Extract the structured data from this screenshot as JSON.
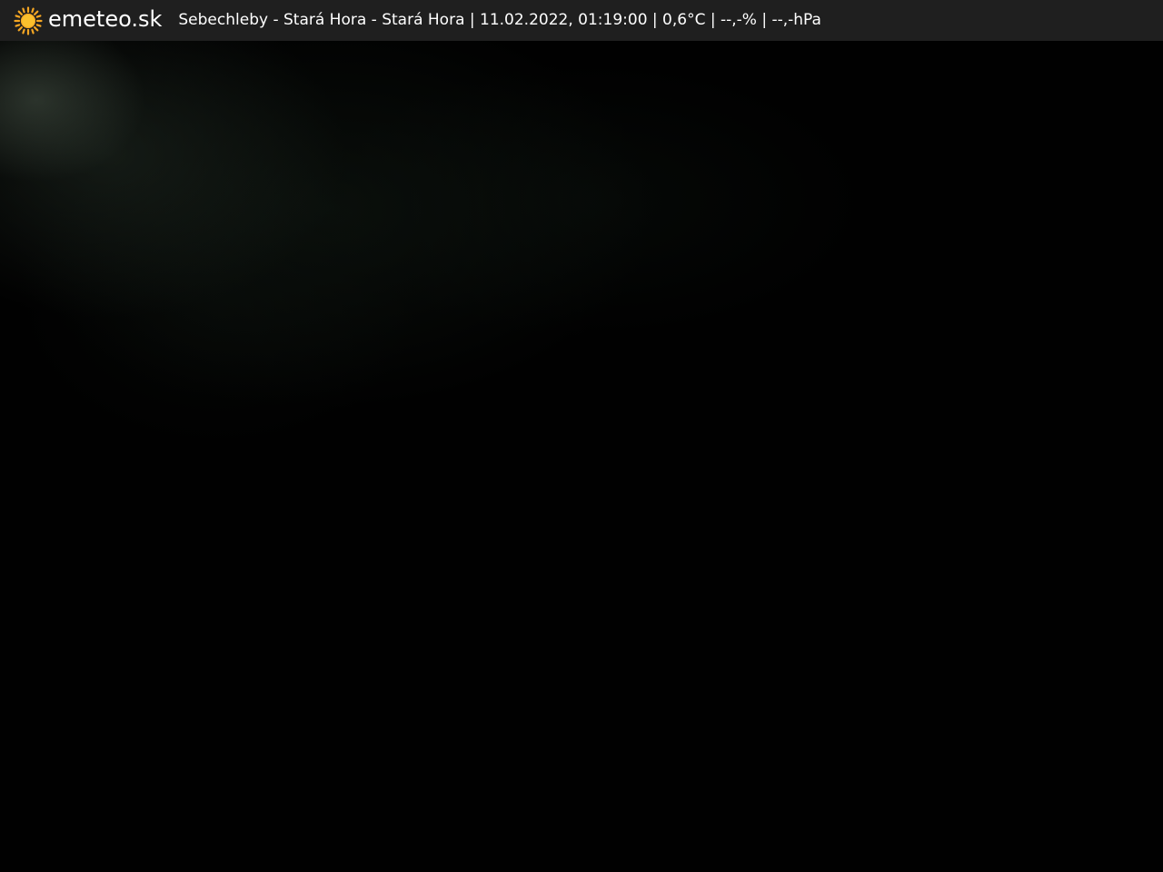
{
  "header": {
    "brand": "emeteo.sk",
    "logo_icon": "sun-icon",
    "caption": "Sebechleby - Stará Hora - Stará Hora | 11.02.2022, 01:19:00 | 0,6°C | --,-% | --,-hPa"
  },
  "colors": {
    "bar_background": "#1f1f1f",
    "text": "#ffffff",
    "sun": "#f5a623",
    "image_background": "#010101"
  }
}
